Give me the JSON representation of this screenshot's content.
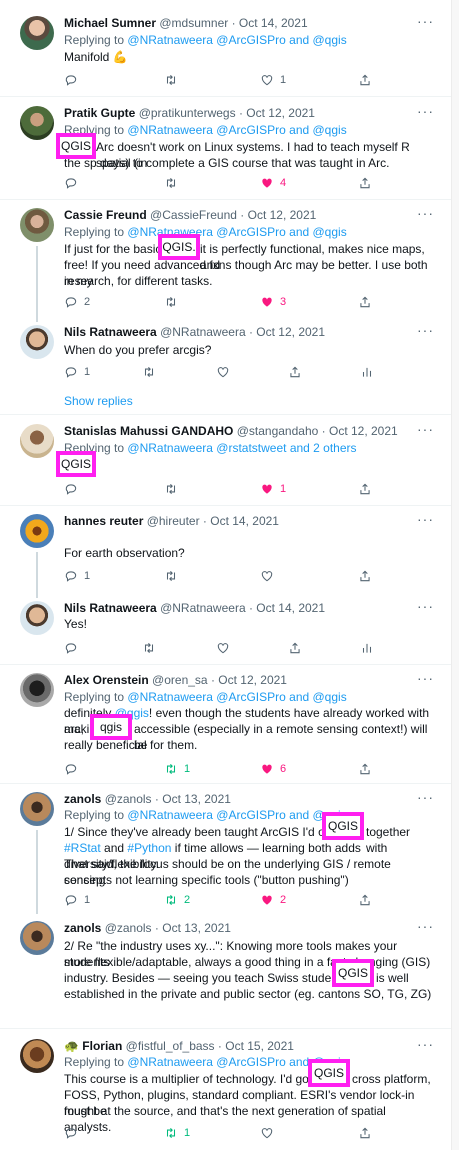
{
  "icons": {
    "reply": "reply-icon",
    "retweet": "retweet-icon",
    "like": "heart-icon",
    "share": "share-icon",
    "analytics": "analytics-icon",
    "more": "more-icon"
  },
  "colors": {
    "link": "#1d9bf0",
    "meta": "#536471",
    "like": "#f91880",
    "retweet": "#00ba7c",
    "highlight": "#ff1ff0"
  },
  "tweets": [
    {
      "name": "Michael Sumner",
      "handle": "@mdsumner",
      "date": "· Oct 14, 2021",
      "replying_prefix": "Replying to",
      "replying_targets": "@NRatnaweera @ArcGISPro and @qgis",
      "text": "Manifold 💪",
      "like_count": "1"
    },
    {
      "name": "Pratik Gupte",
      "handle": "@pratikunterwegs",
      "date": "· Oct 12, 2021",
      "replying_prefix": "Replying to",
      "replying_targets": "@NRatnaweera @ArcGISPro and @qgis",
      "line1": "Arc doesn't work on Linux systems. I had to teach myself R spatial (in",
      "line2": "the sp days) to complete a GIS course that was taught in Arc.",
      "highlight": "QGIS",
      "like_count": "4"
    },
    {
      "name": "Cassie Freund",
      "handle": "@CassieFreund",
      "date": "· Oct 12, 2021",
      "replying_prefix": "Replying to",
      "replying_targets": "@NRatnaweera @ArcGISPro and @qgis",
      "line1a": "If just for the basics,",
      "line1b": "it is perfectly functional, makes nice maps, and",
      "line2": "free! If you need advanced fxns though Arc may be better. I use both in my",
      "line3": "research, for different tasks.",
      "highlight": "QGIS.",
      "reply_count": "2",
      "like_count": "3"
    },
    {
      "name": "Nils Ratnaweera",
      "handle": "@NRatnaweera",
      "date": "· Oct 12, 2021",
      "text": "When do you prefer arcgis?",
      "reply_count": "1",
      "show_replies": "Show replies"
    },
    {
      "name": "Stanislas Mahussi GANDAHO",
      "handle": "@stangandaho",
      "date": "· Oct 12, 2021",
      "replying_prefix": "Replying to",
      "replying_targets": "@NRatnaweera @rstatstweet and 2 others",
      "highlight": "QGIS",
      "like_count": "1"
    },
    {
      "name": "hannes reuter",
      "handle": "@hireuter",
      "date": "· Oct 14, 2021",
      "text": "For earth observation?",
      "reply_count": "1"
    },
    {
      "name": "Nils Ratnaweera",
      "handle": "@NRatnaweera",
      "date": "· Oct 14, 2021",
      "text": "Yes!"
    },
    {
      "name": "Alex Orenstein",
      "handle": "@oren_sa",
      "date": "· Oct 12, 2021",
      "replying_prefix": "Replying to",
      "replying_targets": "@NRatnaweera @ArcGISPro and @qgis",
      "line1a": "definitely",
      "line1link": "@qgis",
      "line1b": "! even though the students have already worked with arc,",
      "line2a": "making",
      "line2b": "accessible (especially in a remote sensing context!) will be",
      "line3": "really beneficial for them.",
      "highlight": "qgis",
      "retweet_count": "1",
      "like_count": "6"
    },
    {
      "name": "zanols",
      "handle": "@zanols",
      "date": "· Oct 13, 2021",
      "replying_prefix": "Replying to",
      "replying_targets": "@NRatnaweera @ArcGISPro and @qgis",
      "line1a": "1/ Since they've already been taught ArcGIS I'd opt for",
      "line1b": "together with",
      "hashtag1": "#RStat",
      "and_word": "and",
      "hashtag2": "#Python",
      "line2rest": "if time allows — learning both adds diversity/flexibility.",
      "line3": "That said, the focus should be on the underlying GIS / remote sensing",
      "line4": "concepts not learning specific tools (\"button pushing\")",
      "highlight": "QGIS",
      "reply_count": "1",
      "retweet_count": "2",
      "like_count": "2"
    },
    {
      "name": "zanols",
      "handle": "@zanols",
      "date": "· Oct 13, 2021",
      "line1": "2/ Re \"the industry uses xy...\": Knowing more tools makes your students",
      "line2": "more flexible/adaptable, always a good thing in a fast changing (GIS)",
      "line3a": "industry. Besides — seeing you teach Swiss students —",
      "line3b": "is well",
      "line4": "established in the private and public sector (eg. cantons SO, TG, ZG)",
      "highlight": "QGIS"
    },
    {
      "name": "Florian",
      "handle": "@fistful_of_bass",
      "date": "· Oct 15, 2021",
      "replying_prefix": "Replying to",
      "replying_targets": "@NRatnaweera @ArcGISPro and @qgis",
      "line1a": "This course is a multiplier of technology. I'd go with",
      "line1b": "cross platform,",
      "line2": "FOSS, Python, plugins, standard compliant. ESRI's vendor lock-in must be",
      "line3": "fought at the source, and that's the next generation of spatial analysts.",
      "highlight": "QGIS",
      "retweet_count": "1"
    }
  ]
}
